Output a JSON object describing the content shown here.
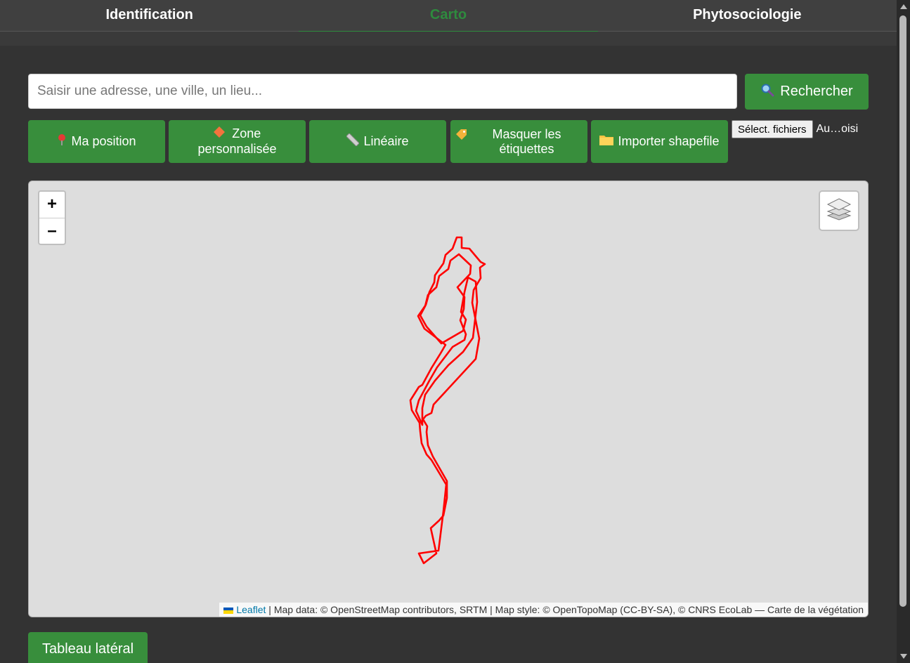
{
  "tabs": [
    {
      "label": "Identification",
      "active": false
    },
    {
      "label": "Carto",
      "active": true
    },
    {
      "label": "Phytosociologie",
      "active": false
    }
  ],
  "search": {
    "placeholder": "Saisir une adresse, une ville, un lieu...",
    "value": "",
    "button_label": "Rechercher",
    "button_icon": "magnifier-icon"
  },
  "tools": [
    {
      "icon": "pin-icon",
      "label": "Ma position"
    },
    {
      "icon": "diamond-icon",
      "label": "Zone personnalisée"
    },
    {
      "icon": "ruler-icon",
      "label": "Linéaire"
    },
    {
      "icon": "tag-icon",
      "label": "Masquer les étiquettes"
    },
    {
      "icon": "folder-icon",
      "label": "Importer shapefile"
    }
  ],
  "file_input": {
    "button_label": "Sélect. fichiers",
    "status": "Au…oisi"
  },
  "map": {
    "zoom_in": "+",
    "zoom_out": "–",
    "layers_icon": "layers-icon",
    "attribution": {
      "link": "Leaflet",
      "text": " | Map data: © OpenStreetMap contributors, SRTM | Map style: © OpenTopoMap (CC-BY-SA), © CNRS EcoLab — Carte de la végétation"
    },
    "trace_color": "#ff0000"
  },
  "bottom_button": {
    "label": "Tableau latéral"
  },
  "colors": {
    "accent": "#388e3c",
    "active_tab": "#2e8b3e",
    "background": "#333333"
  }
}
